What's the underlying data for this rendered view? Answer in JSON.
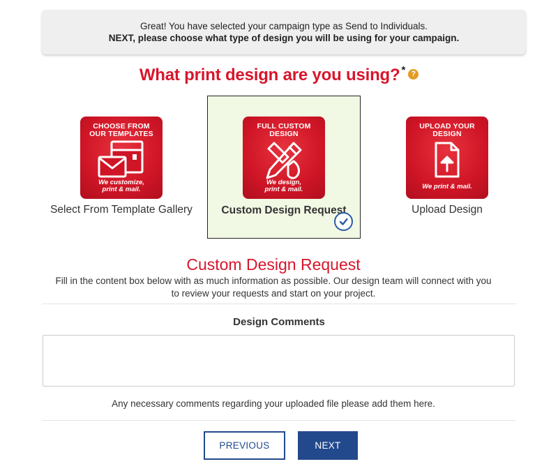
{
  "notice": {
    "line1": "Great! You have selected your campaign type as Send to Individuals.",
    "line2": "NEXT, please choose what type of design you will be using for your campaign."
  },
  "question": {
    "text": "What print design are you using?",
    "required_mark": "*",
    "help_glyph": "?"
  },
  "options": [
    {
      "tile_line1": "CHOOSE FROM",
      "tile_line2": "OUR TEMPLATES",
      "tile_foot1": "We customize,",
      "tile_foot2": "print & mail.",
      "label": "Select From Template Gallery",
      "icon": "postcard-envelope-icon",
      "selected": false
    },
    {
      "tile_line1": "FULL CUSTOM",
      "tile_line2": "DESIGN",
      "tile_foot1": "We design,",
      "tile_foot2": "print & mail.",
      "label": "Custom Design Request",
      "icon": "pencil-brush-icon",
      "selected": true
    },
    {
      "tile_line1": "UPLOAD YOUR",
      "tile_line2": "DESIGN",
      "tile_foot1": "We print & mail.",
      "tile_foot2": "",
      "label": "Upload Design",
      "icon": "file-upload-icon",
      "selected": false
    }
  ],
  "custom_request": {
    "title": "Custom Design Request",
    "description": "Fill in the content box below with as much information as possible. Our design team will connect with you to review your requests and start on your project."
  },
  "comments": {
    "label": "Design Comments",
    "value": "",
    "placeholder": "",
    "help": "Any necessary comments regarding your uploaded file please add them here."
  },
  "buttons": {
    "previous": "PREVIOUS",
    "next": "NEXT"
  },
  "colors": {
    "brand_red": "#d7162c",
    "brand_blue": "#23498d",
    "selected_bg": "#f1f8e4",
    "help_orange": "#e39b24"
  }
}
